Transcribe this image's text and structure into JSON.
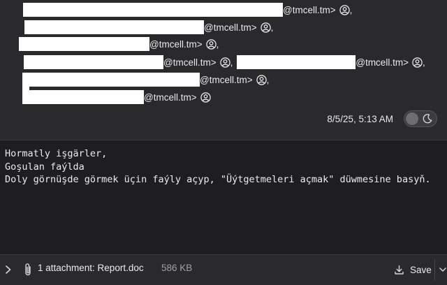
{
  "recipients": {
    "domain_suffix": "@tmcell.tm>",
    "comma": ",",
    "icon": "person-circle-icon"
  },
  "header": {
    "date": "8/5/25, 5:13 AM",
    "appearance_toggle_icon": "moon-icon"
  },
  "body": {
    "lines": [
      "Hormatly işgärler,",
      "Goşulan faýlda",
      "Doly görnüşde görmek üçin faýly açyp, \"Üýtgetmeleri açmak\" düwmesine basyň."
    ]
  },
  "attachment": {
    "label": "1 attachment: Report.doc",
    "size": "586 KB",
    "save_label": "Save"
  },
  "colors": {
    "window_bg": "#2a2a2d",
    "body_bg": "#1e1e20",
    "text": "#ececee",
    "muted_text": "#a0a0a5",
    "redaction": "#ffffff"
  }
}
